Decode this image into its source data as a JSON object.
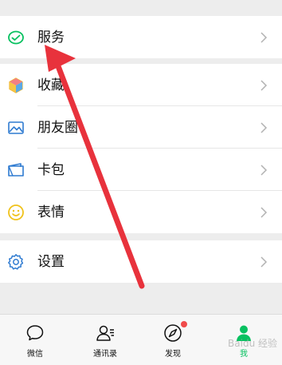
{
  "menu": {
    "services": "服务",
    "favorites": "收藏",
    "moments": "朋友圈",
    "cards": "卡包",
    "stickers": "表情",
    "settings": "设置"
  },
  "tabs": {
    "chats": "微信",
    "contacts": "通讯录",
    "discover": "发现",
    "me": "我"
  },
  "watermark": "Baidu 经验",
  "colors": {
    "accent": "#07c160",
    "arrow": "#e8323c"
  }
}
